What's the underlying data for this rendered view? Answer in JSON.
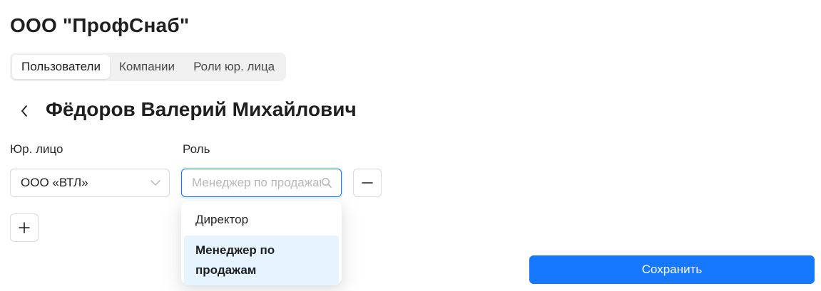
{
  "header": {
    "company_name": "ООО \"ПрофСнаб\""
  },
  "tabs": [
    {
      "label": "Пользователи",
      "active": true
    },
    {
      "label": "Компании",
      "active": false
    },
    {
      "label": "Роли юр. лица",
      "active": false
    }
  ],
  "user": {
    "full_name": "Фёдоров Валерий Михайлович",
    "back_icon": "chevron-left-icon"
  },
  "form": {
    "legal_entity_label": "Юр. лицо",
    "role_label": "Роль",
    "legal_entity_value": "ООО «ВТЛ»",
    "legal_entity_icon": "chevron-down-icon",
    "role_placeholder": "Менеджер по продажам",
    "role_search_icon": "search-icon",
    "remove_icon": "minus-icon",
    "add_icon": "plus-icon"
  },
  "role_dropdown": {
    "options": [
      {
        "label": "Директор",
        "selected": false
      },
      {
        "label": "Менеджер по продажам",
        "selected": true
      }
    ]
  },
  "actions": {
    "save_label": "Сохранить"
  },
  "colors": {
    "primary": "#1677ff",
    "selected_option_bg": "#e6f4ff",
    "tabs_bg": "#f0f0f0"
  }
}
